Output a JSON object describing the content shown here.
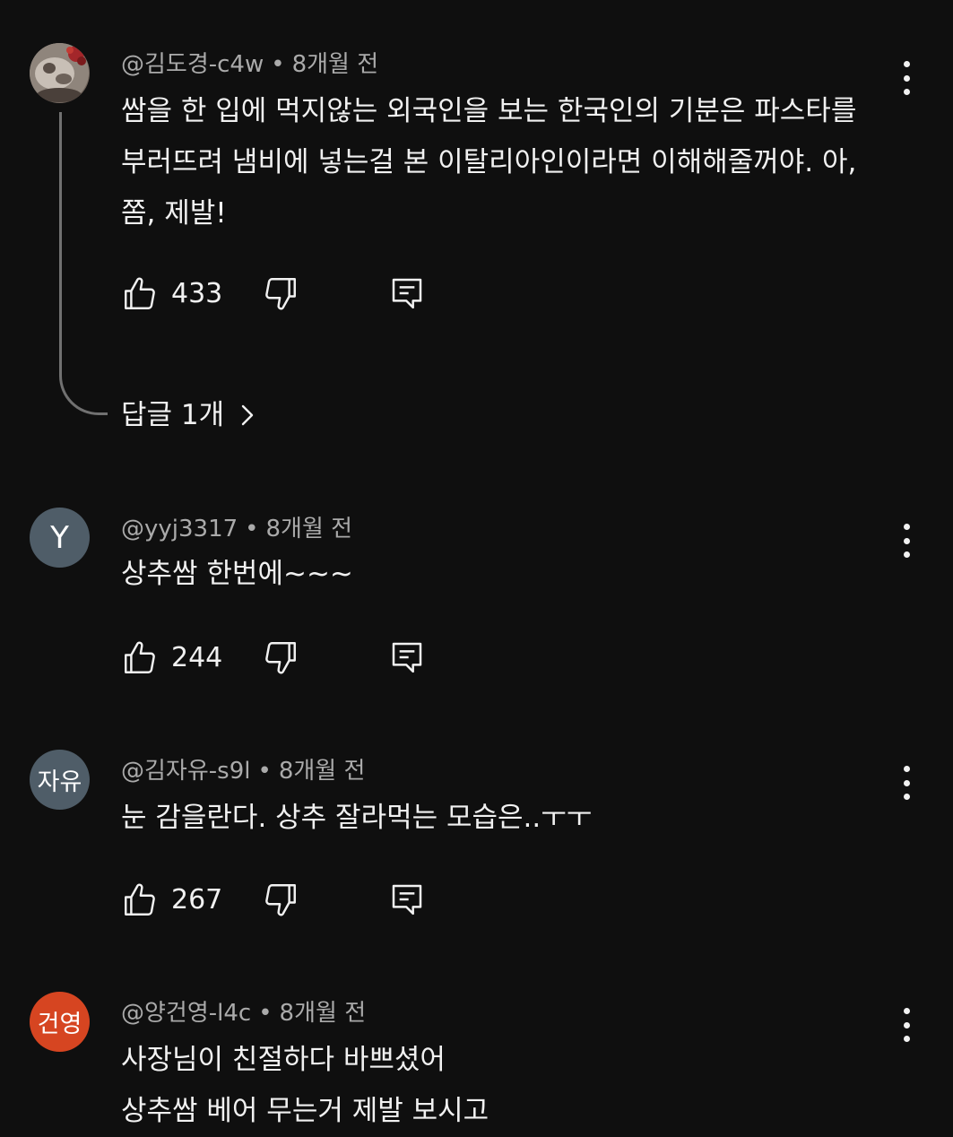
{
  "comments": [
    {
      "avatar": {
        "type": "photo",
        "letter": "",
        "color": "#8d8078"
      },
      "author": "@김도경-c4w",
      "time": "8개월 전",
      "text": "쌈을 한 입에 먹지않는 외국인을 보는 한국인의 기분은 파스타를\n부러뜨려 냄비에 넣는걸 본 이탈리아인이라면 이해해줄꺼야. 아,\n쫌, 제발!",
      "likes": "433",
      "replies_label": "답글 1개"
    },
    {
      "avatar": {
        "type": "letter",
        "letter": "Y",
        "color": "#4f5d68"
      },
      "author": "@yyj3317",
      "time": "8개월 전",
      "text": "상추쌈 한번에~~~",
      "likes": "244"
    },
    {
      "avatar": {
        "type": "letter",
        "letter": "자유",
        "color": "#4f5d68"
      },
      "author": "@김자유-s9l",
      "time": "8개월 전",
      "text": "눈 감을란다. 상추 잘라먹는 모습은..ㅜㅜ",
      "likes": "267"
    },
    {
      "avatar": {
        "type": "letter",
        "letter": "건영",
        "color": "#d64521"
      },
      "author": "@양건영-l4c",
      "time": "8개월 전",
      "text": "사장님이 친절하다 바쁘셨어\n상추쌈 베어 무는거 제발 보시고",
      "likes": ""
    }
  ],
  "icons": {
    "like": "thumbs-up-icon",
    "dislike": "thumbs-down-icon",
    "reply": "comment-reply-icon",
    "more": "more-vert-icon",
    "chevron": "chevron-right-icon"
  },
  "colors": {
    "background": "#0f0f0f",
    "text": "#f1f1f1",
    "meta": "#aaaaaa"
  }
}
